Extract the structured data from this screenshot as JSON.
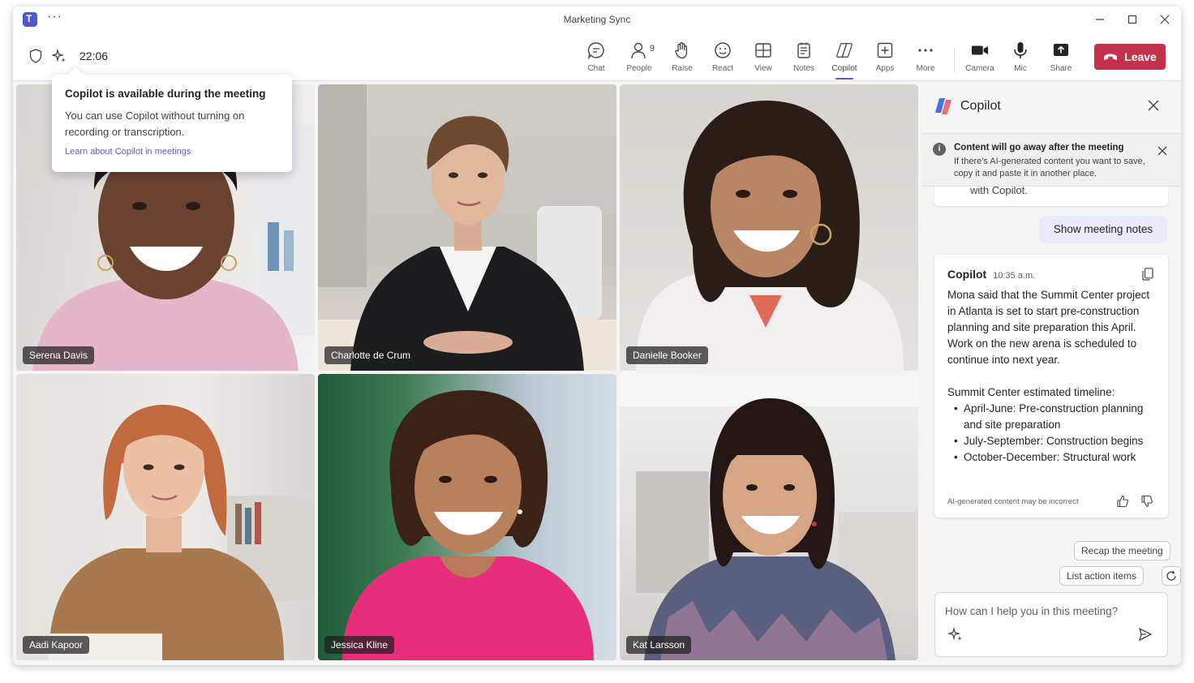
{
  "window": {
    "title": "Marketing Sync"
  },
  "toolbar": {
    "timer": "22:06",
    "buttons": {
      "chat": "Chat",
      "people": "People",
      "people_count": "9",
      "raise": "Raise",
      "react": "React",
      "view": "View",
      "notes": "Notes",
      "copilot": "Copilot",
      "apps": "Apps",
      "more": "More",
      "camera": "Camera",
      "mic": "Mic",
      "share": "Share"
    },
    "leave_label": "Leave",
    "leave_color": "#c4314b",
    "accent_color": "#5b5fc7"
  },
  "tooltip": {
    "title": "Copilot is available during the meeting",
    "body": "You can use Copilot without turning on recording or transcription.",
    "link": "Learn about Copilot in meetings"
  },
  "participants": [
    {
      "name": "Serena Davis"
    },
    {
      "name": "Charlotte de Crum"
    },
    {
      "name": "Danielle Booker"
    },
    {
      "name": "Aadi Kapoor"
    },
    {
      "name": "Jessica Kline"
    },
    {
      "name": "Kat Larsson"
    }
  ],
  "copilot": {
    "title": "Copilot",
    "notice": {
      "title": "Content will go away after the meeting",
      "body": "If there's AI-generated content you want to save, copy it and paste it in another place."
    },
    "previous_text": "with Copilot.",
    "show_notes_label": "Show meeting notes",
    "message": {
      "sender": "Copilot",
      "time": "10:35 a.m.",
      "text": "Mona said that the Summit Center project in Atlanta is set to start pre-construction planning and site preparation this April. Work on the new arena is scheduled to continue into next year.",
      "timeline_title": "Summit Center estimated timeline:",
      "timeline": [
        "April-June: Pre-construction planning and site preparation",
        "July-September: Construction begins",
        "October-December: Structural work"
      ],
      "ai_note": "AI-generated content may be incorrect"
    },
    "suggestions": {
      "recap": "Recap the meeting",
      "actions": "List action items"
    },
    "composer": {
      "placeholder": "How can I help you in this meeting?"
    }
  }
}
